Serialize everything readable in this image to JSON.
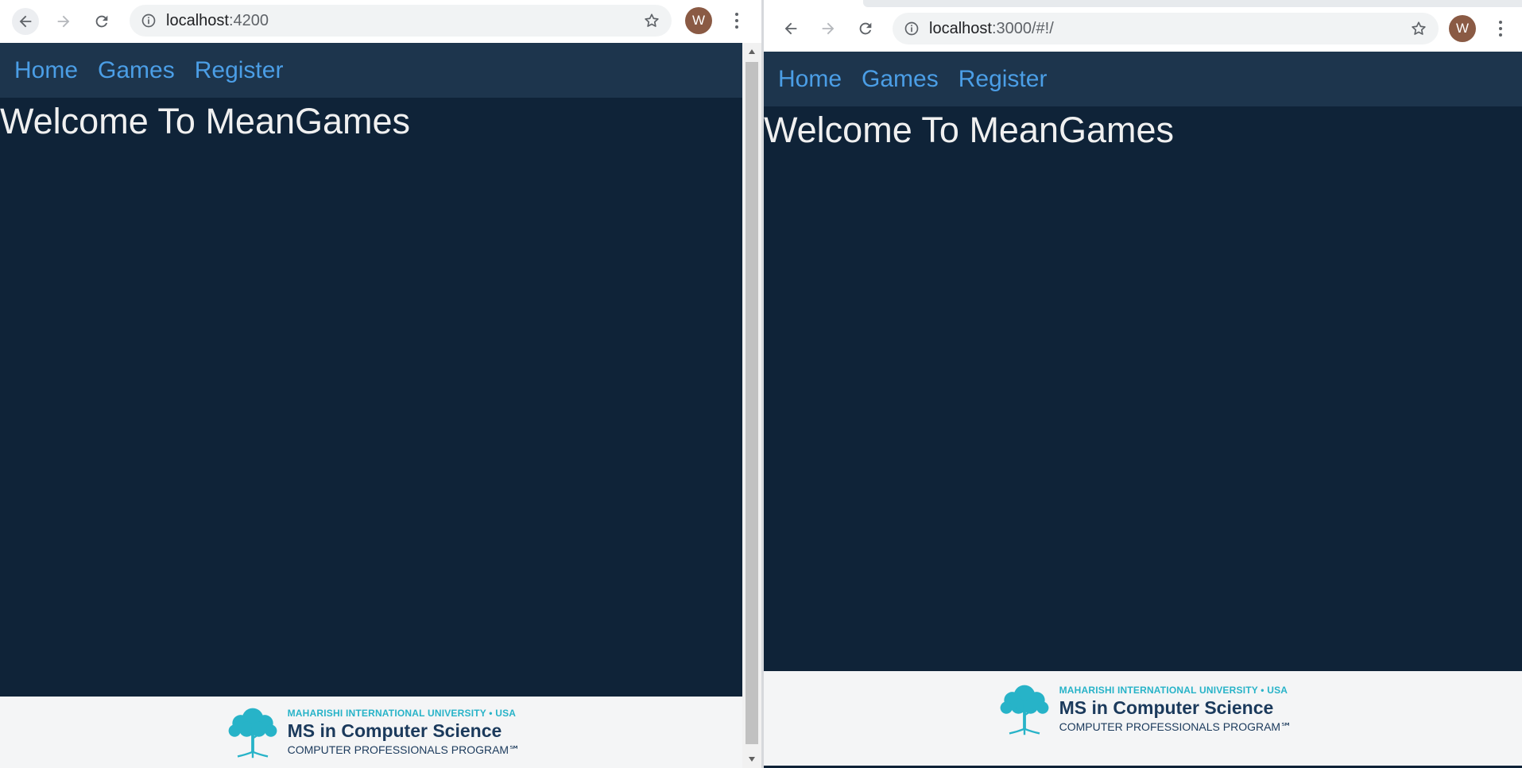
{
  "windows": {
    "left": {
      "url_host": "localhost",
      "url_rest": ":4200",
      "avatar_letter": "W"
    },
    "right": {
      "url_host": "localhost",
      "url_rest": ":3000/#!/",
      "avatar_letter": "W"
    }
  },
  "app": {
    "nav": {
      "home": "Home",
      "games": "Games",
      "register": "Register"
    },
    "welcome": "Welcome To MeanGames"
  },
  "footer_logo": {
    "university": "MAHARISHI INTERNATIONAL UNIVERSITY • USA",
    "degree": "MS in Computer Science",
    "program": "COMPUTER PROFESSIONALS PROGRAM℠"
  },
  "colors": {
    "page_bg": "#0f2338",
    "nav_bg": "#1d354d",
    "link": "#4b9ee6",
    "welcome_text": "#f0f0f0",
    "logo_teal": "#27b3c8",
    "logo_navy": "#1b3a5c"
  },
  "icons": {
    "back": "arrow-left-icon",
    "forward": "arrow-right-icon",
    "reload": "reload-icon",
    "info": "info-icon",
    "star": "star-icon",
    "menu": "kebab-menu-icon",
    "tree": "tree-logo-icon"
  }
}
